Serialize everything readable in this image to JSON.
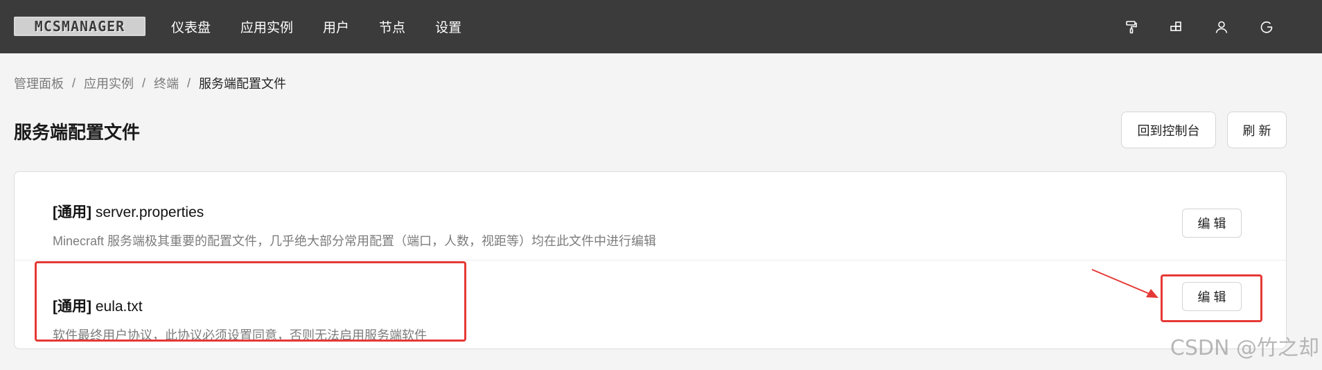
{
  "app": {
    "logo_text": "MCSMANAGER",
    "nav": [
      "仪表盘",
      "应用实例",
      "用户",
      "节点",
      "设置"
    ],
    "top_icons": [
      "paint-roller-icon",
      "app-grid-icon",
      "user-icon",
      "logout-icon"
    ]
  },
  "breadcrumb": [
    "管理面板",
    "应用实例",
    "终端",
    "服务端配置文件"
  ],
  "breadcrumb_sep": "/",
  "page": {
    "title": "服务端配置文件",
    "back_label": "回到控制台",
    "refresh_label": "刷 新"
  },
  "files": [
    {
      "tag": "[通用]",
      "name": "server.properties",
      "desc": "Minecraft 服务端极其重要的配置文件，几乎绝大部分常用配置（端口，人数，视距等）均在此文件中进行编辑",
      "edit_label": "编 辑"
    },
    {
      "tag": "[通用]",
      "name": "eula.txt",
      "desc": "软件最终用户协议，此协议必须设置同意，否则无法启用服务端软件",
      "edit_label": "编 辑"
    }
  ],
  "watermark": "CSDN @竹之却",
  "colors": {
    "topbar": "#3b3b3b",
    "background": "#f4f4f4",
    "annotation": "#e53935"
  }
}
